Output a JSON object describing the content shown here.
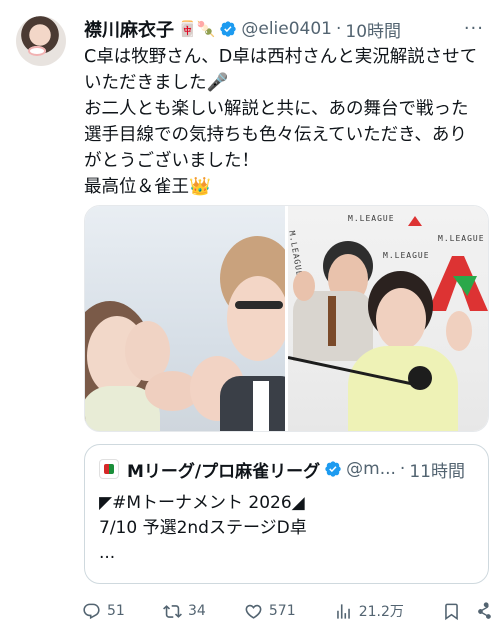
{
  "tweet": {
    "display_name": "襟川麻衣子",
    "name_emoji": "🀄🍡",
    "handle": "@elie0401",
    "separator": "·",
    "time": "10時間",
    "more_label": "···",
    "lines": [
      "C卓は牧野さん、D卓は西村さんと実況解説させて",
      "いただきました🎤",
      "お二人とも楽しい解説と共に、あの舞台で戦った",
      "選手目線での気持ちも色々伝えていただき、あり",
      "がとうございました！",
      "最高位＆雀王👑"
    ]
  },
  "media": {
    "signage": [
      "M.LEAGUE",
      "M.LEAGUE",
      "M.LEAGUE",
      "M.LEAGUE"
    ]
  },
  "quote": {
    "name": "Mリーグ/プロ麻雀リーグ",
    "handle": "@m...",
    "separator": "·",
    "time": "11時間",
    "lines": [
      "◤#Mトーナメント 2026◢",
      "7/10 予選2ndステージD卓",
      "..."
    ]
  },
  "actions": {
    "replies": "51",
    "reposts": "34",
    "likes": "571",
    "views": "21.2万"
  },
  "colors": {
    "text": "#0f1419",
    "secondary": "#536471",
    "verified": "#1d9bf0",
    "border": "#cfd9de"
  },
  "icons": [
    "verified-badge-icon",
    "reply-icon",
    "repost-icon",
    "like-icon",
    "views-icon",
    "bookmark-icon",
    "share-icon"
  ]
}
